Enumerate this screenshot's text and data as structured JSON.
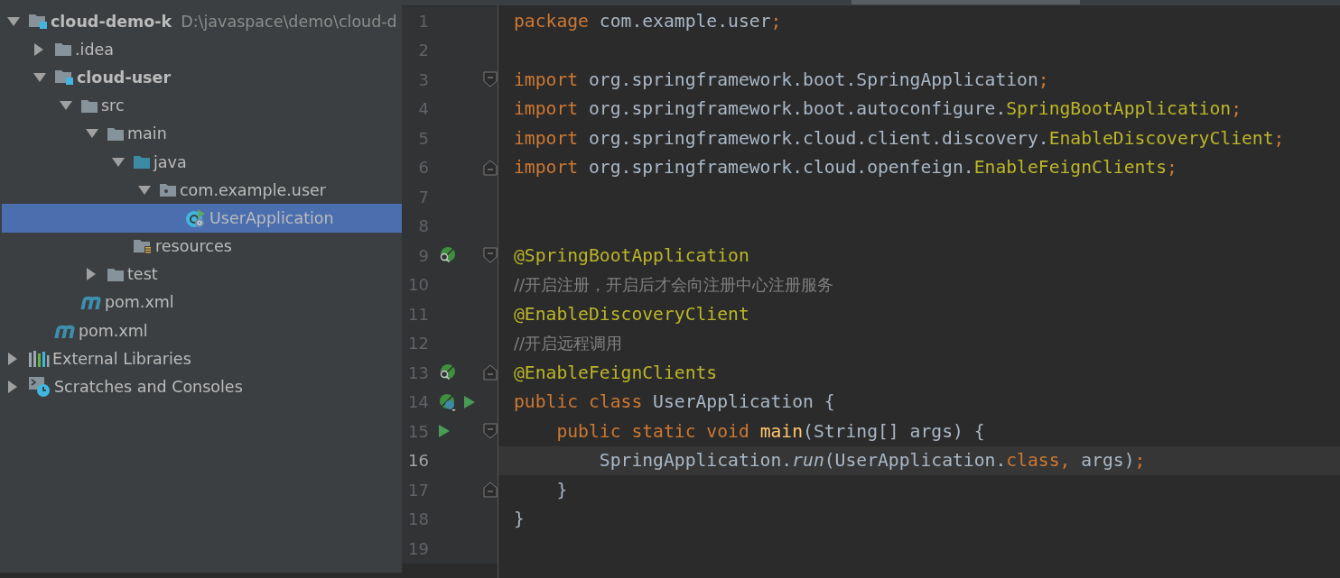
{
  "project_tree": [
    {
      "label": "cloud-demo-k",
      "bold": true,
      "path": "D:\\javaspace\\demo\\cloud-d",
      "kind": "module",
      "expanded": true,
      "selected": false,
      "children": [
        {
          "label": ".idea",
          "bold": false,
          "kind": "folder",
          "expanded": false,
          "selected": false
        },
        {
          "label": "cloud-user",
          "bold": true,
          "kind": "module",
          "expanded": true,
          "selected": false,
          "children": [
            {
              "label": "src",
              "bold": false,
              "kind": "folder",
              "expanded": true,
              "selected": false,
              "children": [
                {
                  "label": "main",
                  "bold": false,
                  "kind": "folder",
                  "expanded": true,
                  "selected": false,
                  "children": [
                    {
                      "label": "java",
                      "bold": false,
                      "kind": "source",
                      "expanded": true,
                      "selected": false,
                      "children": [
                        {
                          "label": "com.example.user",
                          "bold": false,
                          "kind": "package",
                          "expanded": true,
                          "selected": false,
                          "children": [
                            {
                              "label": "UserApplication",
                              "bold": false,
                              "kind": "spring-class",
                              "selected": true
                            }
                          ]
                        }
                      ]
                    },
                    {
                      "label": "resources",
                      "bold": false,
                      "kind": "resources",
                      "selected": false
                    }
                  ]
                },
                {
                  "label": "test",
                  "bold": false,
                  "kind": "folder",
                  "expanded": false,
                  "selected": false
                }
              ]
            },
            {
              "label": "pom.xml",
              "bold": false,
              "kind": "maven",
              "selected": false
            }
          ]
        },
        {
          "label": "pom.xml",
          "bold": false,
          "kind": "maven",
          "selected": false
        }
      ]
    },
    {
      "label": "External Libraries",
      "bold": false,
      "kind": "libraries",
      "expanded": false,
      "selected": false
    },
    {
      "label": "Scratches and Consoles",
      "bold": false,
      "kind": "scratches",
      "expanded": false,
      "selected": false
    }
  ],
  "editor": {
    "lines": [
      {
        "number": "1",
        "current": false,
        "segments": [
          {
            "kind": "keyword",
            "text": "package"
          },
          {
            "kind": "plain",
            "text": " com.example.user"
          },
          {
            "kind": "keyword",
            "text": ";"
          }
        ]
      },
      {
        "number": "2",
        "current": false
      },
      {
        "number": "3",
        "current": false,
        "gutter": [
          {
            "kind": "fold-start"
          }
        ],
        "segments": [
          {
            "kind": "keyword",
            "text": "import"
          },
          {
            "kind": "plain",
            "text": " org.springframework.boot.SpringApplication"
          },
          {
            "kind": "keyword",
            "text": ";"
          }
        ]
      },
      {
        "number": "4",
        "current": false,
        "segments": [
          {
            "kind": "keyword",
            "text": "import"
          },
          {
            "kind": "plain",
            "text": " org.springframework.boot.autoconfigure."
          },
          {
            "kind": "annotation",
            "text": "SpringBootApplication"
          },
          {
            "kind": "keyword",
            "text": ";"
          }
        ]
      },
      {
        "number": "5",
        "current": false,
        "segments": [
          {
            "kind": "keyword",
            "text": "import"
          },
          {
            "kind": "plain",
            "text": " org.springframework.cloud.client.discovery."
          },
          {
            "kind": "annotation",
            "text": "EnableDiscoveryClient"
          },
          {
            "kind": "keyword",
            "text": ";"
          }
        ]
      },
      {
        "number": "6",
        "current": false,
        "gutter": [
          {
            "kind": "fold-end"
          }
        ],
        "segments": [
          {
            "kind": "keyword",
            "text": "import"
          },
          {
            "kind": "plain",
            "text": " org.springframework.cloud.openfeign."
          },
          {
            "kind": "annotation",
            "text": "EnableFeignClients"
          },
          {
            "kind": "keyword",
            "text": ";"
          }
        ]
      },
      {
        "number": "7",
        "current": false
      },
      {
        "number": "8",
        "current": false
      },
      {
        "number": "9",
        "current": false,
        "gutter": [
          {
            "kind": "bean-search"
          },
          {
            "kind": "fold-start"
          }
        ],
        "segments": [
          {
            "kind": "annotation",
            "text": "@SpringBootApplication"
          }
        ]
      },
      {
        "number": "10",
        "current": false,
        "segments": [
          {
            "kind": "comment",
            "text": "//开启注册，开启后才会向注册中心注册服务"
          }
        ]
      },
      {
        "number": "11",
        "current": false,
        "segments": [
          {
            "kind": "annotation",
            "text": "@EnableDiscoveryClient"
          }
        ]
      },
      {
        "number": "12",
        "current": false,
        "segments": [
          {
            "kind": "comment",
            "text": "//开启远程调用"
          }
        ]
      },
      {
        "number": "13",
        "current": false,
        "gutter": [
          {
            "kind": "bean-search"
          },
          {
            "kind": "fold-end"
          }
        ],
        "segments": [
          {
            "kind": "annotation",
            "text": "@EnableFeignClients"
          }
        ]
      },
      {
        "number": "14",
        "current": false,
        "gutter": [
          {
            "kind": "bean-class"
          },
          {
            "kind": "run"
          }
        ],
        "segments": [
          {
            "kind": "keyword",
            "text": "public class "
          },
          {
            "kind": "plain",
            "text": "UserApplication {"
          }
        ]
      },
      {
        "number": "15",
        "current": false,
        "gutter": [
          {
            "kind": "run"
          },
          {
            "kind": "fold-start"
          }
        ],
        "segments": [
          {
            "kind": "keyword",
            "text": "    public static void "
          },
          {
            "kind": "method",
            "text": "main"
          },
          {
            "kind": "plain",
            "text": "(String[] args) {"
          }
        ]
      },
      {
        "number": "16",
        "current": true,
        "segments": [
          {
            "kind": "plain",
            "text": "        SpringApplication."
          },
          {
            "kind": "italic",
            "text": "run"
          },
          {
            "kind": "plain",
            "text": "(UserApplication."
          },
          {
            "kind": "keyword",
            "text": "class, "
          },
          {
            "kind": "plain",
            "text": "args)"
          },
          {
            "kind": "keyword",
            "text": ";"
          }
        ]
      },
      {
        "number": "17",
        "current": false,
        "gutter": [
          {
            "kind": "fold-end"
          }
        ],
        "segments": [
          {
            "kind": "plain",
            "text": "    }"
          }
        ]
      },
      {
        "number": "18",
        "current": false,
        "segments": [
          {
            "kind": "plain",
            "text": "}"
          }
        ]
      },
      {
        "number": "19",
        "current": false
      }
    ]
  }
}
